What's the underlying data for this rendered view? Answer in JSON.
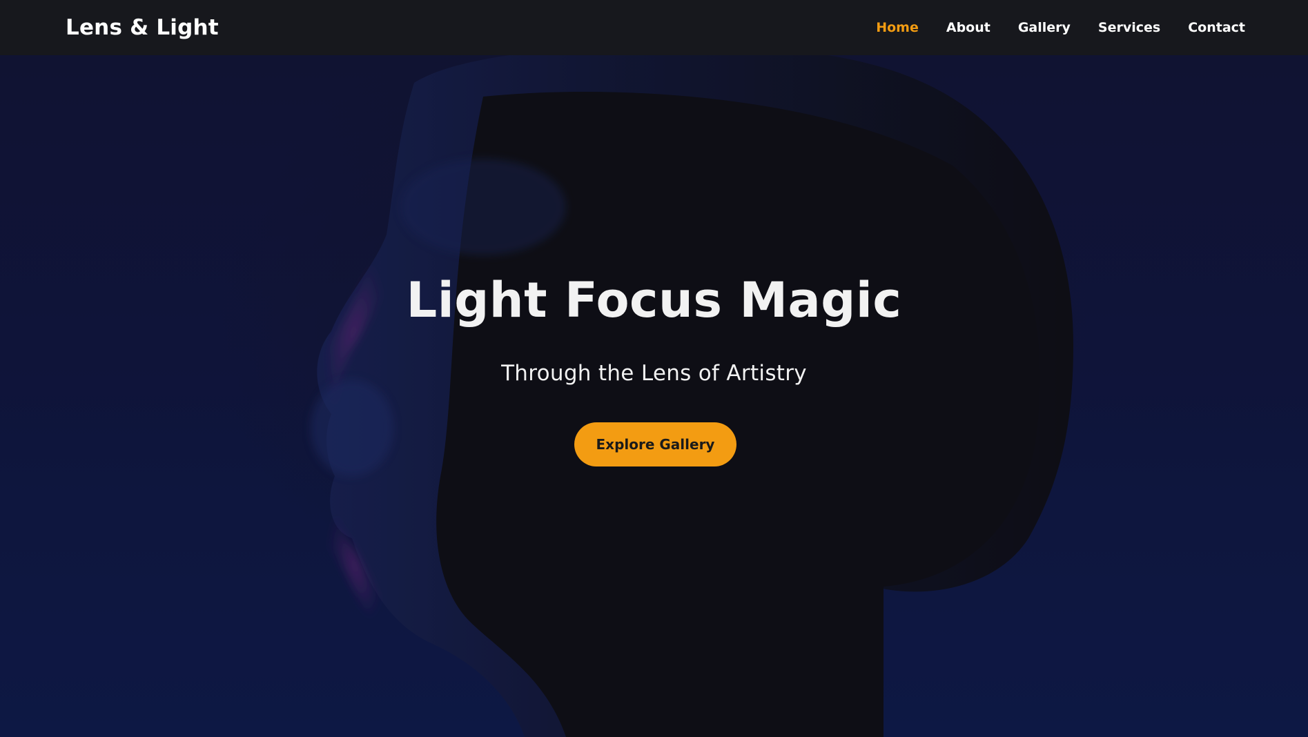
{
  "header": {
    "brand": "Lens & Light",
    "nav": [
      {
        "label": "Home",
        "active": true
      },
      {
        "label": "About",
        "active": false
      },
      {
        "label": "Gallery",
        "active": false
      },
      {
        "label": "Services",
        "active": false
      },
      {
        "label": "Contact",
        "active": false
      }
    ]
  },
  "hero": {
    "title": "Light Focus Magic",
    "subtitle": "Through the Lens of Artistry",
    "cta_label": "Explore Gallery"
  },
  "colors": {
    "accent": "#f39c12",
    "navbar_bg": "#17181d",
    "hero_bg": "#121843",
    "text_light": "#f2f2f2"
  }
}
